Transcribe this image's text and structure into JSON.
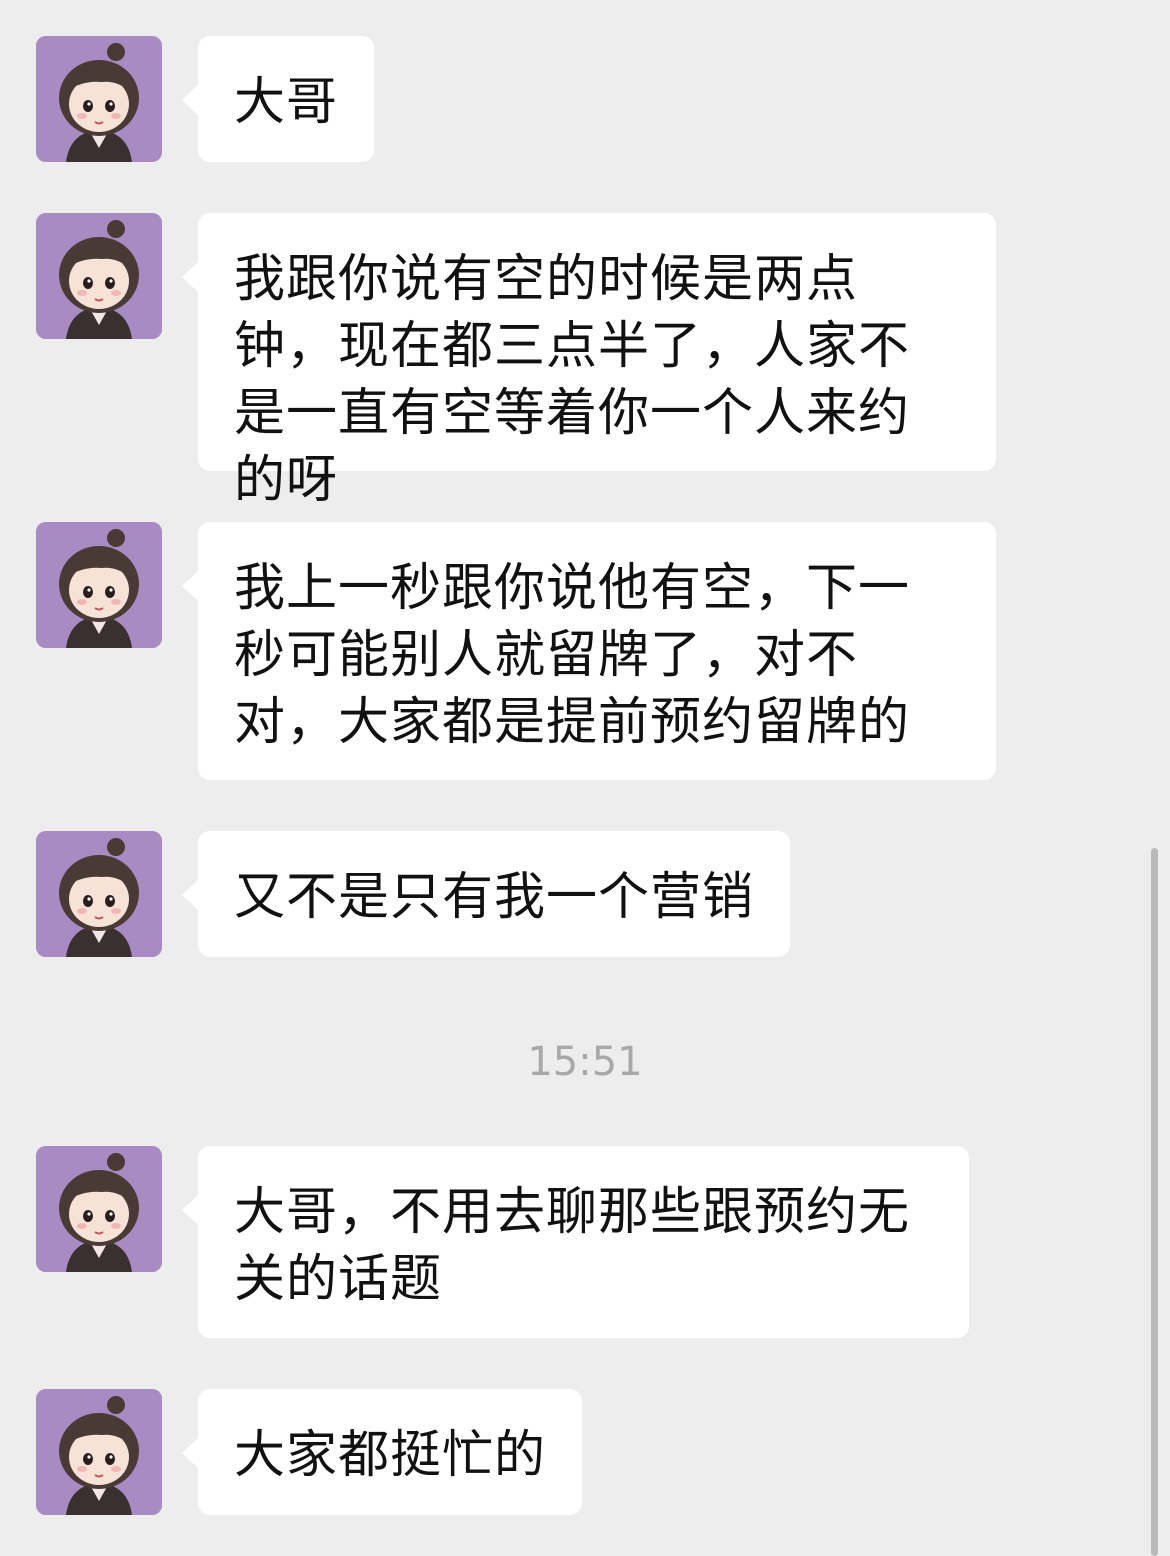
{
  "contact": {
    "avatar_icon": "girl-avatar-icon",
    "avatar_bg": "#a98bc4"
  },
  "messages": [
    {
      "text": "大哥"
    },
    {
      "text": "我跟你说有空的时候是两点钟，现在都三点半了，人家不是一直有空等着你一个人来约的呀"
    },
    {
      "text": "我上一秒跟你说他有空，下一秒可能别人就留牌了，对不对，大家都是提前预约留牌的"
    },
    {
      "text": "又不是只有我一个营销"
    },
    {
      "text": "大哥，不用去聊那些跟预约无关的话题"
    },
    {
      "text": "大家都挺忙的"
    }
  ],
  "timestamp": "15:51",
  "colors": {
    "background": "#ededed",
    "bubble": "#ffffff",
    "text": "#111111",
    "timestamp": "#a8a8a8"
  }
}
